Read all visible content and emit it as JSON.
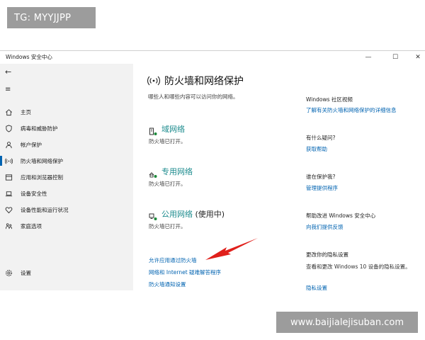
{
  "watermarks": {
    "top": "TG: MYYJJPP",
    "bottom": "www.baijialejisuban.com"
  },
  "window": {
    "title": "Windows 安全中心",
    "controls": {
      "minimize": "—",
      "maximize": "☐",
      "close": "✕"
    }
  },
  "sidebar": {
    "back": "←",
    "menu": "≡",
    "items": [
      {
        "label": "主页",
        "icon": "home-icon"
      },
      {
        "label": "病毒和威胁防护",
        "icon": "shield-icon"
      },
      {
        "label": "帐户保护",
        "icon": "person-icon"
      },
      {
        "label": "防火墙和网络保护",
        "icon": "wifi-signal-icon",
        "active": true
      },
      {
        "label": "应用和浏览器控制",
        "icon": "app-window-icon"
      },
      {
        "label": "设备安全性",
        "icon": "laptop-icon"
      },
      {
        "label": "设备性能和运行状况",
        "icon": "heart-icon"
      },
      {
        "label": "家庭选项",
        "icon": "family-icon"
      }
    ],
    "settings": {
      "label": "设置",
      "icon": "gear-icon"
    }
  },
  "main": {
    "title": "防火墙和网络保护",
    "subtitle": "哪些人和哪些内容可以访问你的网络。",
    "networks": [
      {
        "name": "域网络",
        "in_use": "",
        "status": "防火墙已打开。",
        "icon": "domain-network-icon"
      },
      {
        "name": "专用网络",
        "in_use": "",
        "status": "防火墙已打开。",
        "icon": "private-network-icon"
      },
      {
        "name": "公用网络",
        "in_use": " (使用中)",
        "status": "防火墙已打开。",
        "icon": "public-network-icon"
      }
    ],
    "links": [
      "允许应用通过防火墙",
      "网络和 Internet 疑难解答程序",
      "防火墙通知设置"
    ]
  },
  "right": {
    "community": {
      "heading": "Windows 社区视频",
      "link": "了解有关防火墙和网络保护的详细信息"
    },
    "question": {
      "heading": "有什么疑问?",
      "link": "获取帮助"
    },
    "protect": {
      "heading": "谁在保护我?",
      "link": "管理提供程序"
    },
    "improve": {
      "heading": "帮助改进 Windows 安全中心",
      "link": "向我们提供反馈"
    },
    "privacy": {
      "heading": "更改你的隐私设置",
      "text": "查看和更改 Windows 10 设备的隐私设置。",
      "link": "隐私设置"
    }
  },
  "colors": {
    "accent": "#0063b1",
    "network_teal": "#1a8a8c",
    "arrow": "#e0201b",
    "sidebar_bg": "#f2f2f2"
  }
}
